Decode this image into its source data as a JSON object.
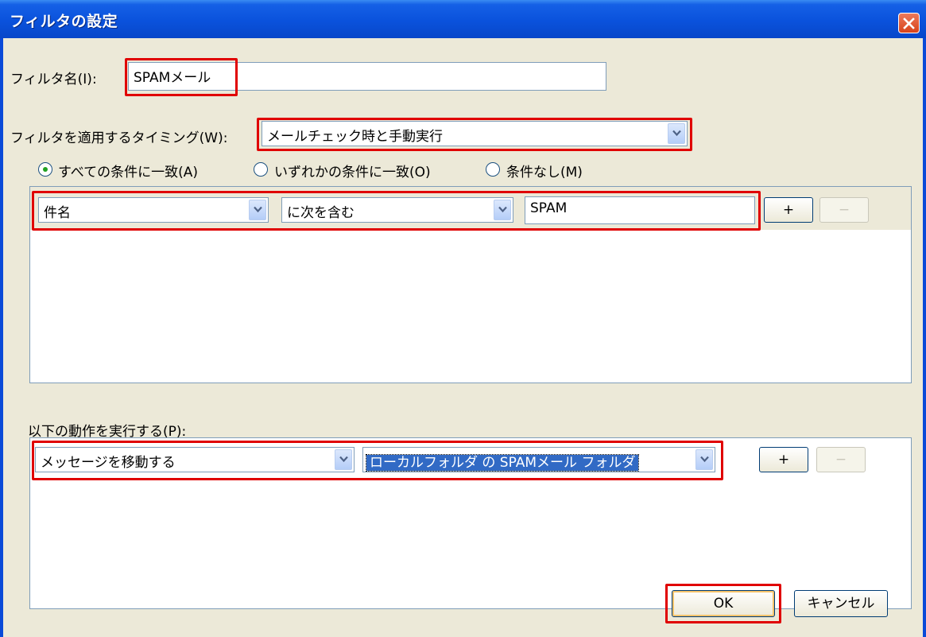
{
  "window": {
    "title": "フィルタの設定"
  },
  "filter_name": {
    "label": "フィルタ名(I):",
    "value": "SPAMメール"
  },
  "timing": {
    "label": "フィルタを適用するタイミング(W):",
    "value": "メールチェック時と手動実行"
  },
  "match_mode": {
    "options": [
      {
        "label": "すべての条件に一致(A)",
        "selected": true
      },
      {
        "label": "いずれかの条件に一致(O)",
        "selected": false
      },
      {
        "label": "条件なし(M)",
        "selected": false
      }
    ]
  },
  "conditions": [
    {
      "field": "件名",
      "operator": "に次を含む",
      "value": "SPAM",
      "add_label": "+",
      "remove_label": "−"
    }
  ],
  "actions_label": "以下の動作を実行する(P):",
  "actions": [
    {
      "action": "メッセージを移動する",
      "target": "ローカルフォルダ の SPAMメール フォルダ",
      "add_label": "+",
      "remove_label": "−"
    }
  ],
  "buttons": {
    "ok": "OK",
    "cancel": "キャンセル"
  },
  "colors": {
    "highlight": "#e00000",
    "titlebar": "#0a52dc",
    "dialog_bg": "#ece9d8"
  }
}
